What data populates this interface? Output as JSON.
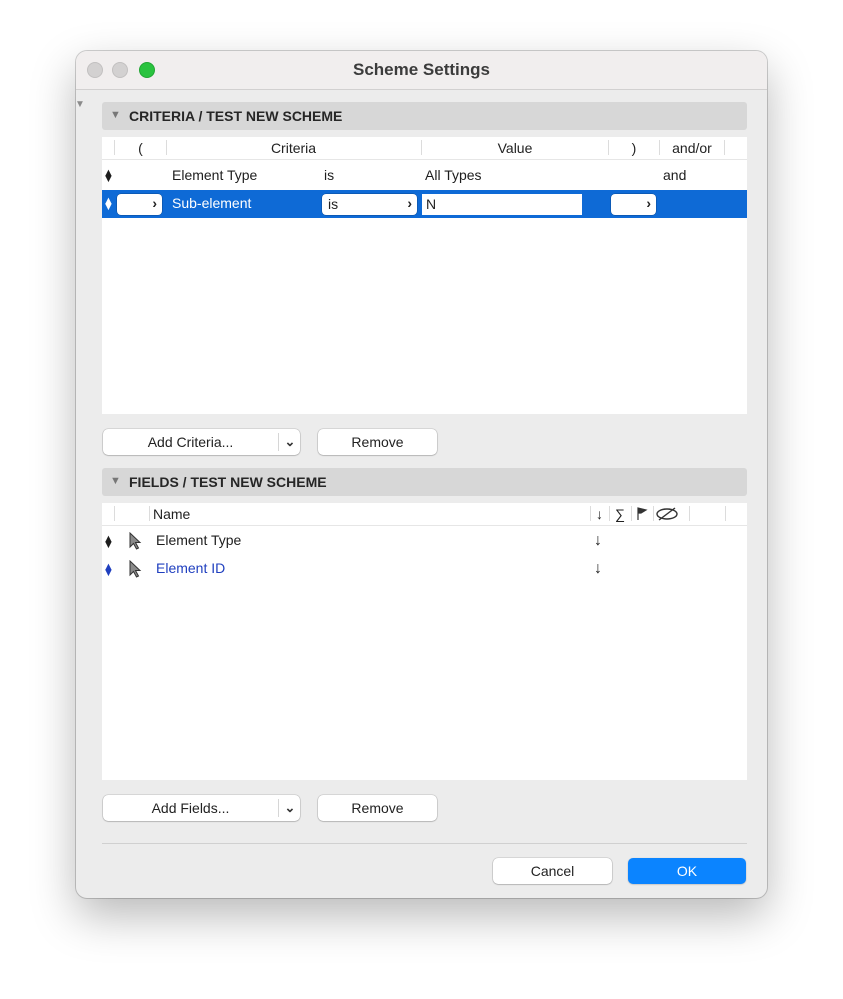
{
  "window": {
    "title": "Scheme Settings"
  },
  "criteria": {
    "header": "CRITERIA / TEST NEW SCHEME",
    "columns": {
      "open": "(",
      "criteria": "Criteria",
      "value": "Value",
      "close": ")",
      "andor": "and/or"
    },
    "rows": [
      {
        "criteria": "Element Type",
        "operator": "is",
        "value": "All Types",
        "andor": "and"
      },
      {
        "criteria": "Sub-element",
        "operator": "is",
        "value": "N",
        "andor": "",
        "selected": true
      }
    ],
    "add_button": "Add Criteria...",
    "remove_button": "Remove"
  },
  "fields": {
    "header": "FIELDS / TEST NEW SCHEME",
    "columns": {
      "name": "Name",
      "sort": "↓",
      "sum": "∑",
      "flag": "flag-icon",
      "hide": "hidden-eye-icon"
    },
    "rows": [
      {
        "name": "Element Type",
        "sort": "↓",
        "color": "#1d1d1d"
      },
      {
        "name": "Element ID",
        "sort": "↓",
        "color": "#1f3fbf"
      }
    ],
    "add_button": "Add Fields...",
    "remove_button": "Remove"
  },
  "footer": {
    "cancel": "Cancel",
    "ok": "OK"
  },
  "colors": {
    "selection": "#0e6ad6",
    "ok_button": "#0b84ff",
    "zoom_light": "#2ac33f"
  }
}
